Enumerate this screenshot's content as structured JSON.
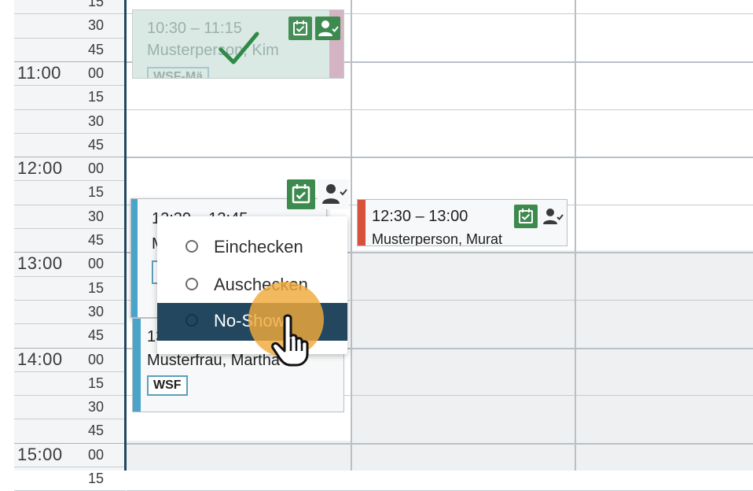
{
  "time_gutter": {
    "rows": [
      {
        "hour": "",
        "min": "15"
      },
      {
        "hour": "",
        "min": "30"
      },
      {
        "hour": "",
        "min": "45"
      },
      {
        "hour": "11:00",
        "min": "00"
      },
      {
        "hour": "",
        "min": "15"
      },
      {
        "hour": "",
        "min": "30"
      },
      {
        "hour": "",
        "min": "45"
      },
      {
        "hour": "12:00",
        "min": "00"
      },
      {
        "hour": "",
        "min": "15"
      },
      {
        "hour": "",
        "min": "30"
      },
      {
        "hour": "",
        "min": "45"
      },
      {
        "hour": "13:00",
        "min": "00"
      },
      {
        "hour": "",
        "min": "15"
      },
      {
        "hour": "",
        "min": "30"
      },
      {
        "hour": "",
        "min": "45"
      },
      {
        "hour": "14:00",
        "min": "00"
      },
      {
        "hour": "",
        "min": "15"
      },
      {
        "hour": "",
        "min": "30"
      },
      {
        "hour": "",
        "min": "45"
      },
      {
        "hour": "15:00",
        "min": "00"
      },
      {
        "hour": "",
        "min": "15"
      }
    ]
  },
  "appointments": {
    "a1": {
      "time": "10:30 – 11:15",
      "name": "Musterperson, Kim",
      "tag": "WSF-Mä",
      "state": "checked-in"
    },
    "a2": {
      "time": "12:30 – 13:45",
      "name": "M",
      "tag": ""
    },
    "a3": {
      "time": "13",
      "name": "Musterfrau, Martha",
      "tag": "WSF"
    },
    "a4": {
      "time": "12:30 – 13:00",
      "name": "Musterperson, Murat"
    }
  },
  "status_menu": {
    "items": [
      {
        "label": "Einchecken",
        "selected": false
      },
      {
        "label": "Auschecken",
        "selected": false
      },
      {
        "label": "No-Show",
        "selected": false,
        "highlighted": true
      }
    ]
  },
  "icons": {
    "calendar_check": "calendar-check-icon",
    "person_check": "person-check-icon",
    "checkmark": "checkmark-icon",
    "hand_pointer": "hand-pointer-icon"
  },
  "colors": {
    "accent_dark": "#22475f",
    "green": "#3d8a4f",
    "appt_blue": "#4aa3c9",
    "appt_red": "#d8513a",
    "appt_pink": "#d4b3c4",
    "cursor_highlight": "#f0a93a"
  }
}
